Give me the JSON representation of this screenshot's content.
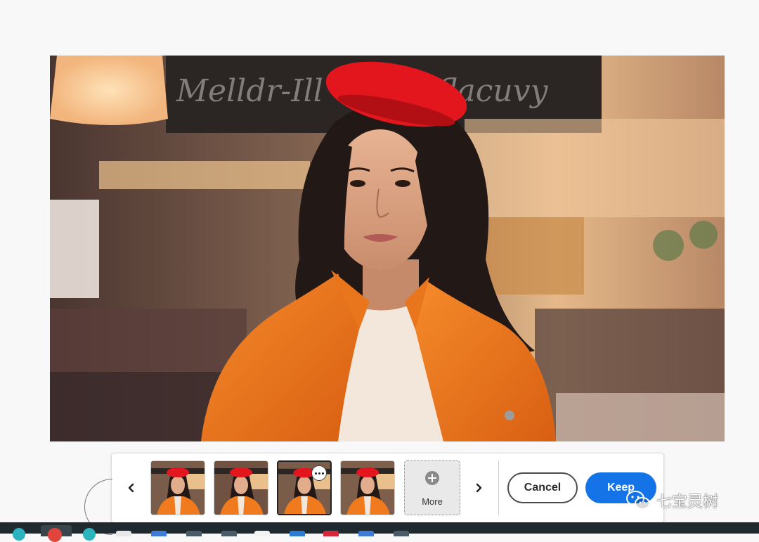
{
  "canvas": {
    "image_alt": "Portrait of a woman in a red beret and orange jacket in a café"
  },
  "variations": {
    "prev_icon": "chevron-left-icon",
    "next_icon": "chevron-right-icon",
    "thumbnails": [
      {
        "icon": "variation-thumbnail",
        "selected": false
      },
      {
        "icon": "variation-thumbnail",
        "selected": false
      },
      {
        "icon": "variation-thumbnail",
        "selected": true
      },
      {
        "icon": "variation-thumbnail",
        "selected": false
      }
    ],
    "more_label": "More",
    "more_icon": "plus-circle-icon",
    "options_icon": "more-options-icon"
  },
  "actions": {
    "cancel_label": "Cancel",
    "keep_label": "Keep"
  },
  "watermark": {
    "text": "七宝灵树",
    "icon": "wechat-icon"
  },
  "colors": {
    "accent": "#1473e6",
    "jacket": "#f07a1e",
    "beret": "#e3161e",
    "taskbar": "#1f2a30"
  }
}
